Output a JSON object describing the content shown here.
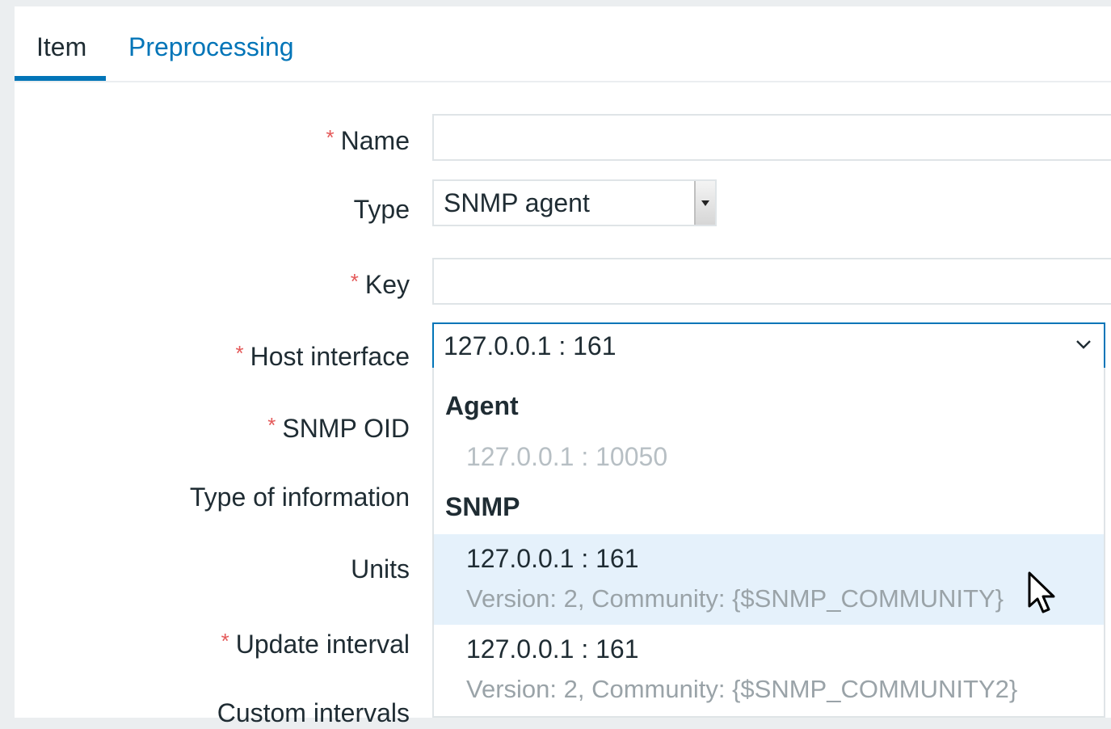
{
  "tabs": [
    {
      "label": "Item",
      "active": true
    },
    {
      "label": "Preprocessing",
      "active": false
    }
  ],
  "form": {
    "required_marker": "*",
    "name_label": "Name",
    "name_value": "",
    "type_label": "Type",
    "type_value": "SNMP agent",
    "key_label": "Key",
    "key_value": "",
    "host_interface_label": "Host interface",
    "host_interface_value": "127.0.0.1 : 161",
    "snmp_oid_label": "SNMP OID",
    "type_of_information_label": "Type of information",
    "units_label": "Units",
    "update_interval_label": "Update interval",
    "custom_intervals_label": "Custom intervals"
  },
  "dropdown": {
    "groups": [
      {
        "label": "Agent",
        "options": [
          {
            "address": "127.0.0.1 : 10050",
            "disabled": true
          }
        ]
      },
      {
        "label": "SNMP",
        "options": [
          {
            "address": "127.0.0.1 : 161",
            "details": "Version: 2, Community: {$SNMP_COMMUNITY}",
            "highlighted": true
          },
          {
            "address": "127.0.0.1 : 161",
            "details": "Version: 2, Community: {$SNMP_COMMUNITY2}",
            "highlighted": false
          }
        ]
      }
    ]
  },
  "colors": {
    "accent": "#0275b8",
    "required": "#e45959",
    "highlight": "#e5f1fb",
    "background": "#ebeef0"
  }
}
